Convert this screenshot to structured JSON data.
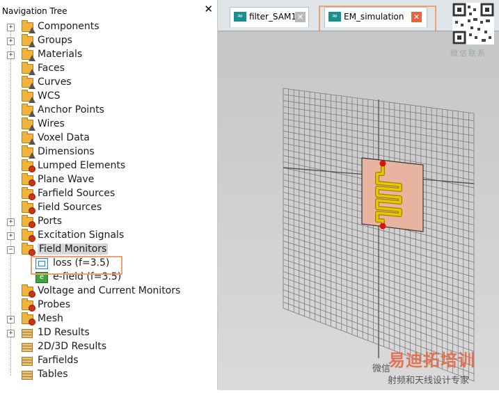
{
  "nav": {
    "title": "Navigation Tree",
    "items": [
      {
        "label": "Components",
        "expander": "+",
        "icon": "folder",
        "badge": "tri"
      },
      {
        "label": "Groups",
        "expander": "+",
        "icon": "folder",
        "badge": "tri"
      },
      {
        "label": "Materials",
        "expander": "+",
        "icon": "folder",
        "badge": "tri"
      },
      {
        "label": "Faces",
        "expander": "",
        "icon": "folder",
        "badge": "tri"
      },
      {
        "label": "Curves",
        "expander": "",
        "icon": "folder",
        "badge": "tri"
      },
      {
        "label": "WCS",
        "expander": "",
        "icon": "folder",
        "badge": "tri"
      },
      {
        "label": "Anchor Points",
        "expander": "",
        "icon": "folder",
        "badge": "tri"
      },
      {
        "label": "Wires",
        "expander": "",
        "icon": "folder",
        "badge": "tri"
      },
      {
        "label": "Voxel Data",
        "expander": "",
        "icon": "folder",
        "badge": "tri"
      },
      {
        "label": "Dimensions",
        "expander": "",
        "icon": "folder",
        "badge": "tri"
      },
      {
        "label": "Lumped Elements",
        "expander": "",
        "icon": "folder",
        "badge": "gear"
      },
      {
        "label": "Plane Wave",
        "expander": "",
        "icon": "folder",
        "badge": "gear"
      },
      {
        "label": "Farfield Sources",
        "expander": "",
        "icon": "folder",
        "badge": "gear"
      },
      {
        "label": "Field Sources",
        "expander": "",
        "icon": "folder",
        "badge": "gear"
      },
      {
        "label": "Ports",
        "expander": "+",
        "icon": "folder",
        "badge": "gear"
      },
      {
        "label": "Excitation Signals",
        "expander": "+",
        "icon": "folder",
        "badge": "gear"
      },
      {
        "label": "Field Monitors",
        "expander": "−",
        "icon": "folder",
        "badge": "gear",
        "selected": true
      },
      {
        "label": "loss (f=3.5)",
        "expander": "",
        "icon": "loss",
        "indent": 1
      },
      {
        "label": "e-field (f=3.5)",
        "expander": "",
        "icon": "efield",
        "indent": 1
      },
      {
        "label": "Voltage and Current Monitors",
        "expander": "",
        "icon": "folder",
        "badge": "gear"
      },
      {
        "label": "Probes",
        "expander": "",
        "icon": "folder",
        "badge": "gear"
      },
      {
        "label": "Mesh",
        "expander": "+",
        "icon": "folder",
        "badge": "gear"
      },
      {
        "label": "1D Results",
        "expander": "+",
        "icon": "stack"
      },
      {
        "label": "2D/3D Results",
        "expander": "",
        "icon": "stack"
      },
      {
        "label": "Farfields",
        "expander": "",
        "icon": "stack"
      },
      {
        "label": "Tables",
        "expander": "",
        "icon": "stack"
      }
    ]
  },
  "tabs": [
    {
      "label": "filter_SAM1",
      "active": false,
      "close_icon": "close-icon-grey"
    },
    {
      "label": "EM_simulation",
      "active": true,
      "close_icon": "close-icon-orange"
    }
  ],
  "icons": {
    "tab_icon": "≈",
    "close": "✕",
    "efield_letter": "e"
  },
  "qr": {
    "caption": "微信联系"
  },
  "watermark": {
    "title": "易迪拓培训",
    "left": "微信",
    "subtitle": "射频和天线设计专家"
  },
  "colors": {
    "highlight": "#f0a070",
    "tab_close_active": "#e8643c",
    "filter_trace": "#d9b800",
    "port_dot": "#dd1111",
    "substrate": "#e8b4a0"
  }
}
